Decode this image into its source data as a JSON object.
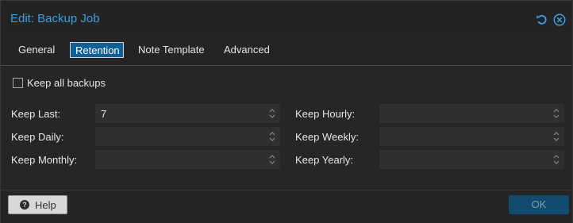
{
  "window": {
    "title": "Edit: Backup Job",
    "accent_color": "#3b9ee0"
  },
  "tools": {
    "reset_icon": "undo-icon",
    "close_icon": "close-icon"
  },
  "tabs": [
    {
      "label": "General",
      "active": false
    },
    {
      "label": "Retention",
      "active": true
    },
    {
      "label": "Note Template",
      "active": false
    },
    {
      "label": "Advanced",
      "active": false
    }
  ],
  "retention": {
    "keep_all": {
      "label": "Keep all backups",
      "checked": false
    },
    "fields": {
      "keep_last": {
        "label": "Keep Last:",
        "value": "7",
        "placeholder": ""
      },
      "keep_hourly": {
        "label": "Keep Hourly:",
        "value": "",
        "placeholder": ""
      },
      "keep_daily": {
        "label": "Keep Daily:",
        "value": "",
        "placeholder": ""
      },
      "keep_weekly": {
        "label": "Keep Weekly:",
        "value": "",
        "placeholder": ""
      },
      "keep_monthly": {
        "label": "Keep Monthly:",
        "value": "",
        "placeholder": ""
      },
      "keep_yearly": {
        "label": "Keep Yearly:",
        "value": "",
        "placeholder": ""
      }
    }
  },
  "footer": {
    "help_label": "Help",
    "help_icon": "question-circle-icon",
    "ok_label": "OK",
    "ok_color": "#114b6e"
  }
}
